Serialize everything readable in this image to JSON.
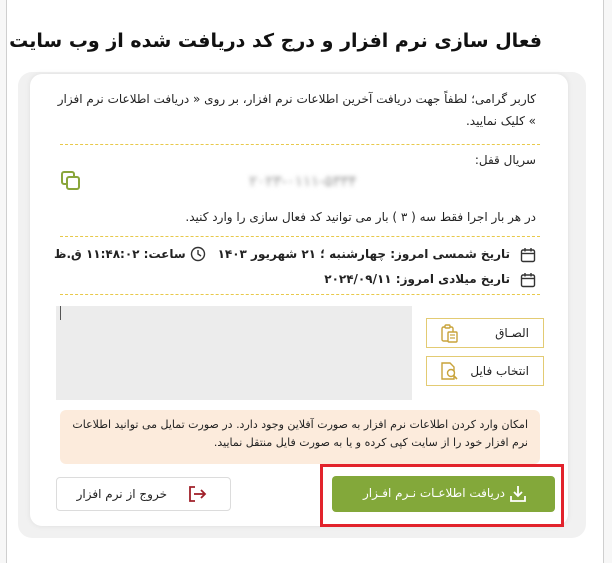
{
  "page": {
    "title": "فعال سازی نرم افزار و درج کد دریافت شده از وب سایت"
  },
  "info": {
    "text": "کاربر گرامی؛ لطفاً جهت دریافت آخرین اطلاعات نرم افزار، بر روی « دریافت اطلاعات نرم افزار » کلیک نمایید."
  },
  "serial": {
    "label": "سریال قفل:",
    "value": "۲۰۲۳-۰۱۱۱-۵۳۳۴"
  },
  "notes": {
    "enter_limit": "در هر بار اجرا فقط سه ( ۳ ) بار می توانید کد فعال سازی را وارد کنید."
  },
  "datetime": {
    "shamsi": "تاریخ شمسی امروز: چهارشنبه ؛ ۲۱ شهریور ۱۴۰۳",
    "gregorian": "تاریخ میلادی امروز: ۲۰۲۴/۰۹/۱۱",
    "time": "ساعت: ۱۱:۴۸:۰۲ ق.ظ"
  },
  "buttons": {
    "paste": "الصـاق",
    "select_file": "انتخاب فایل",
    "download_info": "دریافت اطلاعـات نـرم افـزار",
    "exit": "خروج از نرم افزار"
  },
  "warning": {
    "text": "امکان وارد کردن اطلاعات نرم افزار به صورت آفلاین وجود دارد. در صورت تمایل می توانید اطلاعات نرم افزار خود را از سایت کپی کرده و یا به صورت فایل منتقل نمایید."
  },
  "colors": {
    "accent_green": "#83a83a",
    "highlight_red": "#e2232c",
    "dash_yellow": "#e8c94a",
    "warning_bg": "#fcebdc"
  }
}
